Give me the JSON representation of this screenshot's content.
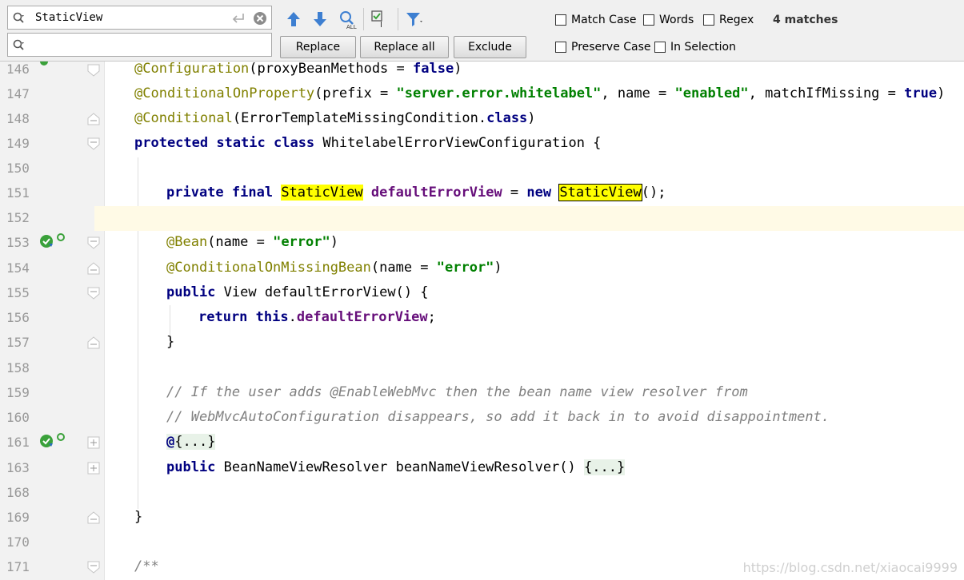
{
  "find_bar": {
    "search_value": "StaticView",
    "replace_value": "",
    "buttons": {
      "replace": "Replace",
      "replace_all": "Replace all",
      "exclude": "Exclude"
    },
    "options": {
      "match_case": "Match Case",
      "words": "Words",
      "regex": "Regex",
      "preserve_case": "Preserve Case",
      "in_selection": "In Selection"
    },
    "match_count": "4 matches"
  },
  "editor": {
    "line_numbers": {
      "l146": "146",
      "l147": "147",
      "l148": "148",
      "l149": "149",
      "l150": "150",
      "l151": "151",
      "l152": "152",
      "l153": "153",
      "l154": "154",
      "l155": "155",
      "l156": "156",
      "l157": "157",
      "l158": "158",
      "l159": "159",
      "l160": "160",
      "l161": "161",
      "l163": "163",
      "l168": "168",
      "l169": "169",
      "l170": "170",
      "l171": "171"
    },
    "code": {
      "l146_ann": "@Configuration",
      "l146_rest": "(proxyBeanMethods = ",
      "l146_kw": "false",
      "l146_end": ")",
      "l147_ann": "@ConditionalOnProperty",
      "l147_a": "(prefix = ",
      "l147_s1": "\"server.error.whitelabel\"",
      "l147_b": ", name = ",
      "l147_s2": "\"enabled\"",
      "l147_c": ", matchIfMissing = ",
      "l147_kw": "true",
      "l147_end": ")",
      "l148_ann": "@Conditional",
      "l148_a": "(ErrorTemplateMissingCondition.",
      "l148_kw": "class",
      "l148_end": ")",
      "l149_kw": "protected static class",
      "l149_rest": " WhitelabelErrorViewConfiguration {",
      "l151_kw1": "private final",
      "l151_m1": "StaticView",
      "l151_fld": "defaultErrorView",
      "l151_eq": " = ",
      "l151_kw2": "new",
      "l151_m2": "StaticView",
      "l151_end": "();",
      "l153_ann": "@Bean",
      "l153_a": "(name = ",
      "l153_s": "\"error\"",
      "l153_end": ")",
      "l154_ann": "@ConditionalOnMissingBean",
      "l154_a": "(name = ",
      "l154_s": "\"error\"",
      "l154_end": ")",
      "l155_kw": "public",
      "l155_rest": " View defaultErrorView() {",
      "l156_kw1": "return",
      "l156_kw2": "this",
      "l156_dot": ".",
      "l156_fld": "defaultErrorView",
      "l156_end": ";",
      "l157": "}",
      "l159_cm": "// If the user adds @EnableWebMvc then the bean name view resolver from",
      "l160_cm": "// WebMvcAutoConfiguration disappears, so add it back in to avoid disappointment.",
      "l161_at": "@",
      "l161_fold": "{...}",
      "l163_kw": "public",
      "l163_rest": " BeanNameViewResolver beanNameViewResolver() ",
      "l163_fold": "{...}",
      "l169": "}",
      "l171_cm": "/**"
    }
  },
  "watermark": "https://blog.csdn.net/xiaocai9999",
  "colors": {
    "annotation": "#808000",
    "keyword": "#000080",
    "string": "#008000",
    "field": "#660e7a",
    "comment": "#808080",
    "match_highlight": "#ffff00",
    "current_line": "#fffae6"
  }
}
